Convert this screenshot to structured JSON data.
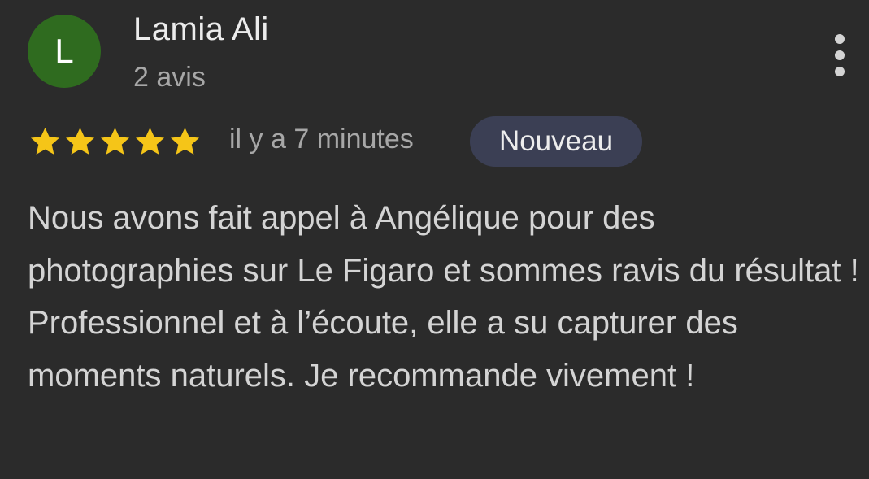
{
  "review": {
    "author": {
      "initial": "L",
      "name": "Lamia Ali",
      "review_count": "2 avis",
      "avatar_color": "#2f6b1f"
    },
    "more_options_icon": "more-vert-icon",
    "rating": {
      "value": 5,
      "max": 5,
      "star_color": "#f5c518"
    },
    "time": "il y a 7 minutes",
    "badge": "Nouveau",
    "text": "Nous avons fait appel à Angélique pour des photographies sur Le Figaro et sommes ravis du résultat ! Professionnel et à l’écoute, elle a su capturer des moments naturels. Je recommande vivement !"
  }
}
